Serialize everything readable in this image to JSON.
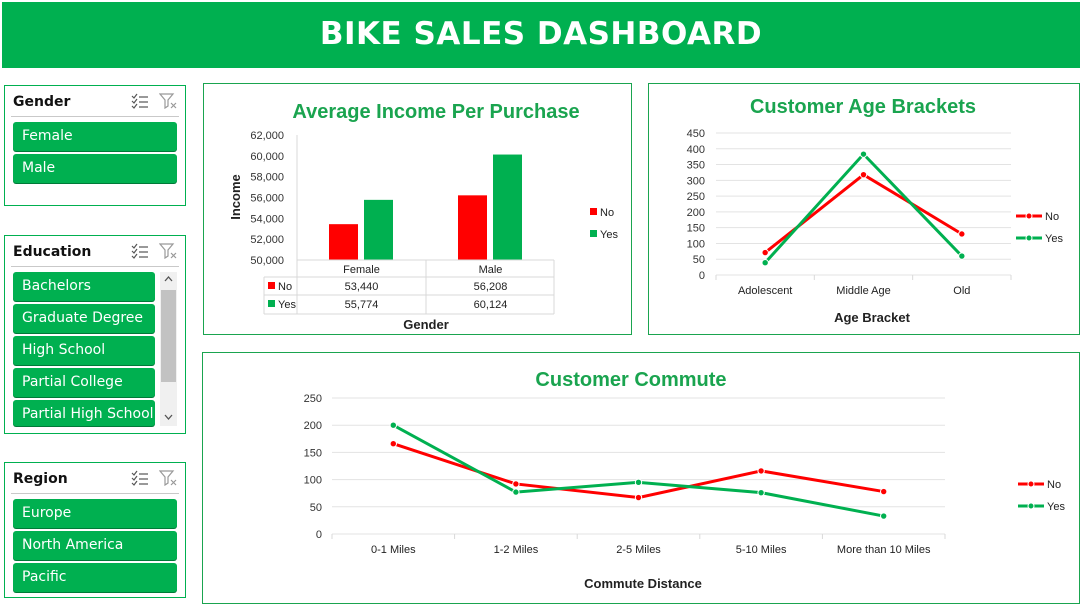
{
  "header": {
    "title": "BIKE SALES DASHBOARD"
  },
  "slicers": {
    "gender": {
      "title": "Gender",
      "items": [
        "Female",
        "Male"
      ]
    },
    "education": {
      "title": "Education",
      "items": [
        "Bachelors",
        "Graduate Degree",
        "High School",
        "Partial College",
        "Partial High School"
      ]
    },
    "region": {
      "title": "Region",
      "items": [
        "Europe",
        "North America",
        "Pacific"
      ]
    }
  },
  "colors": {
    "accent": "#00b050",
    "no": "#ff0000",
    "yes": "#00b050",
    "title_green": "#1aa44f"
  },
  "chart_data": [
    {
      "type": "bar",
      "title": "Average Income Per Purchase",
      "xlabel": "Gender",
      "ylabel": "Income",
      "categories": [
        "Female",
        "Male"
      ],
      "ylim": [
        50000,
        62000
      ],
      "yticks": [
        "62,000",
        "60,000",
        "58,000",
        "56,000",
        "54,000",
        "52,000",
        "50,000"
      ],
      "series": [
        {
          "name": "No",
          "values": [
            53440,
            56208
          ],
          "labels": [
            "53,440",
            "56,208"
          ]
        },
        {
          "name": "Yes",
          "values": [
            55774,
            60124
          ],
          "labels": [
            "55,774",
            "60,124"
          ]
        }
      ],
      "legend": "right",
      "data_table": true
    },
    {
      "type": "line",
      "title": "Customer Age Brackets",
      "xlabel": "Age Bracket",
      "ylabel": "",
      "categories": [
        "Adolescent",
        "Middle Age",
        "Old"
      ],
      "ylim": [
        0,
        450
      ],
      "yticks": [
        "450",
        "400",
        "350",
        "300",
        "250",
        "200",
        "150",
        "100",
        "50",
        "0"
      ],
      "series": [
        {
          "name": "No",
          "values": [
            71,
            318,
            130
          ]
        },
        {
          "name": "Yes",
          "values": [
            39,
            383,
            60
          ]
        }
      ],
      "legend": "right",
      "grid": true
    },
    {
      "type": "line",
      "title": "Customer Commute",
      "xlabel": "Commute Distance",
      "ylabel": "",
      "categories": [
        "0-1 Miles",
        "1-2 Miles",
        "2-5 Miles",
        "5-10 Miles",
        "More than 10 Miles"
      ],
      "ylim": [
        0,
        250
      ],
      "yticks": [
        "250",
        "200",
        "150",
        "100",
        "50",
        "0"
      ],
      "series": [
        {
          "name": "No",
          "values": [
            166,
            92,
            67,
            116,
            78
          ]
        },
        {
          "name": "Yes",
          "values": [
            200,
            77,
            95,
            76,
            33
          ]
        }
      ],
      "legend": "right",
      "grid": true
    }
  ]
}
